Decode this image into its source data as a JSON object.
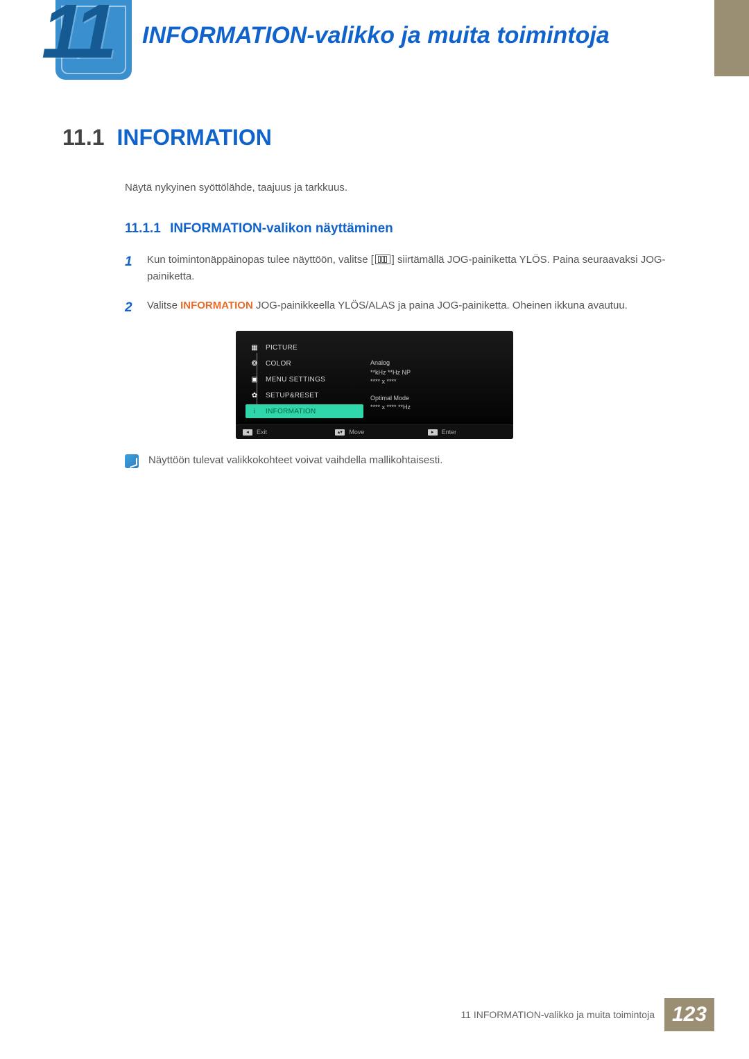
{
  "chapter": {
    "number": "11",
    "title": "INFORMATION-valikko ja muita toimintoja"
  },
  "section": {
    "number": "11.1",
    "title": "INFORMATION",
    "intro": "Näytä nykyinen syöttölähde, taajuus ja tarkkuus."
  },
  "subsection": {
    "number": "11.1.1",
    "title": "INFORMATION-valikon näyttäminen"
  },
  "steps": [
    {
      "num": "1",
      "pre": "Kun toimintonäppäinopas tulee näyttöön, valitse [",
      "post": "] siirtämällä JOG-painiketta YLÖS. Paina seuraavaksi JOG-painiketta."
    },
    {
      "num": "2",
      "pre": "Valitse ",
      "keyword": "INFORMATION",
      "post": " JOG-painikkeella YLÖS/ALAS ja paina JOG-painiketta. Oheinen ikkuna avautuu."
    }
  ],
  "osd": {
    "items": [
      {
        "label": "PICTURE",
        "icon": "▦"
      },
      {
        "label": "COLOR",
        "icon": "❂"
      },
      {
        "label": "MENU SETTINGS",
        "icon": "▣"
      },
      {
        "label": "SETUP&RESET",
        "icon": "✿"
      },
      {
        "label": "INFORMATION",
        "icon": "i",
        "selected": true
      }
    ],
    "info": {
      "line1": "Analog",
      "line2": "**kHz **Hz NP",
      "line3": "**** x ****",
      "line4": "Optimal Mode",
      "line5": "**** x **** **Hz"
    },
    "footer": {
      "exit": "Exit",
      "move": "Move",
      "enter": "Enter"
    }
  },
  "note": "Näyttöön tulevat valikkokohteet voivat vaihdella mallikohtaisesti.",
  "footer": {
    "text": "11 INFORMATION-valikko ja muita toimintoja",
    "page": "123"
  }
}
